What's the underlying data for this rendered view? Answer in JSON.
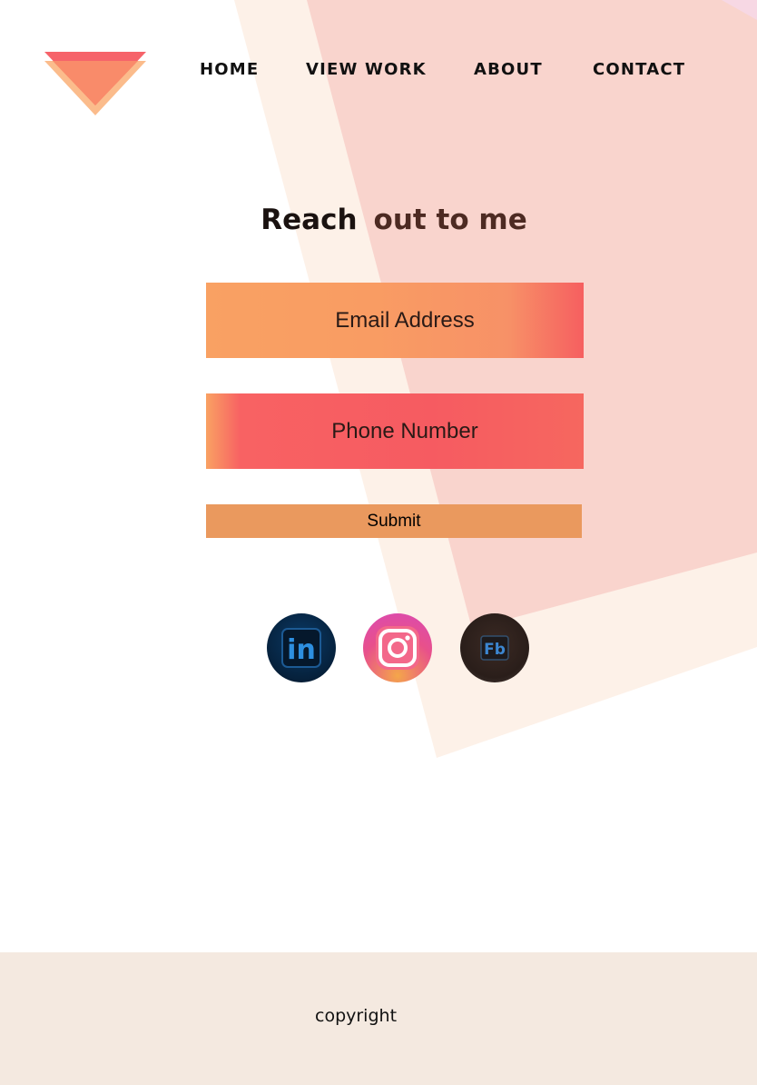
{
  "nav": {
    "home": "HOME",
    "view_work": "VIEW WORK",
    "about": "ABOUT",
    "contact": "CONTACT"
  },
  "heading": {
    "word1": "Reach",
    "word2": "out to me"
  },
  "form": {
    "email_placeholder": "Email Address",
    "phone_placeholder": "Phone Number",
    "submit_label": "Submit"
  },
  "social": {
    "linkedin_text": "in",
    "facebook_text": "Fb"
  },
  "footer": {
    "copyright": "copyright"
  },
  "colors": {
    "background_cream": "#fdf1e8",
    "background_pink": "#f9d4cd",
    "email_gradient_main": "#f99c63",
    "phone_gradient_main": "#f65b61",
    "submit": "#ea995e",
    "footer": "#f4e9e0",
    "logo_red": "#f6636a",
    "logo_orange": "#f98b6a",
    "logo_peach": "#fbbc8c"
  },
  "icons": [
    "logo-triangle-icon",
    "linkedin-icon",
    "instagram-icon",
    "facebook-icon"
  ]
}
